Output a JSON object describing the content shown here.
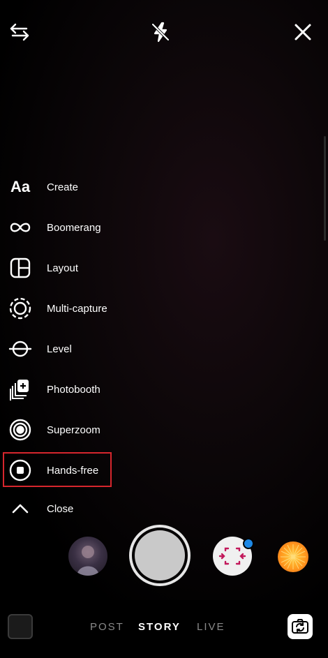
{
  "top_bar": {
    "left_icon": "swap-arrows-icon",
    "center_icon": "flash-off-icon",
    "right_icon": "close-icon"
  },
  "menu": {
    "items": [
      {
        "label": "Create",
        "icon": "text-aa-icon"
      },
      {
        "label": "Boomerang",
        "icon": "infinity-icon"
      },
      {
        "label": "Layout",
        "icon": "layout-grid-icon"
      },
      {
        "label": "Multi-capture",
        "icon": "multi-capture-icon"
      },
      {
        "label": "Level",
        "icon": "level-icon"
      },
      {
        "label": "Photobooth",
        "icon": "photobooth-icon"
      },
      {
        "label": "Superzoom",
        "icon": "superzoom-icon"
      },
      {
        "label": "Hands-free",
        "icon": "hands-free-icon"
      },
      {
        "label": "Close",
        "icon": "chevron-up-icon"
      }
    ],
    "create_glyph": "Aa",
    "highlighted": "Hands-free",
    "highlight_color": "#d6262d"
  },
  "capture": {
    "effects": [
      "avatar-effect",
      "scan-effect",
      "sun-effect"
    ],
    "notification_dot_color": "#1e88e5"
  },
  "modes": {
    "items": [
      "POST",
      "STORY",
      "LIVE"
    ],
    "active": "STORY"
  }
}
